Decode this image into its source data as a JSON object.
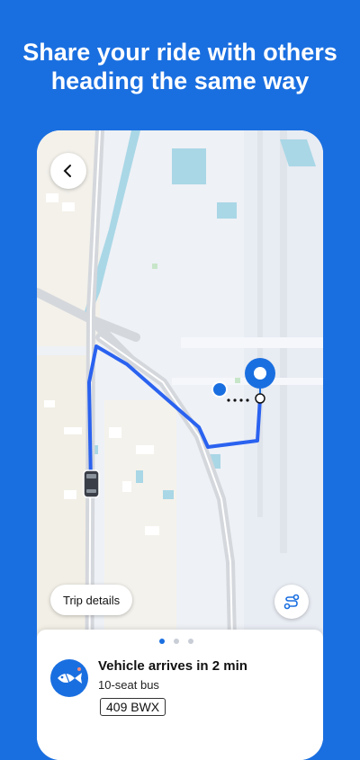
{
  "headline": {
    "line1": "Share your ride with others",
    "line2": "heading the same way"
  },
  "colors": {
    "brand_blue": "#1a6fe0",
    "route_blue": "#2a62f0",
    "map_land": "#eef1f6",
    "map_water": "#a9d7e6",
    "map_road": "#d4d7dc"
  },
  "map": {
    "back_icon": "chevron-left-icon",
    "trip_details_label": "Trip details",
    "route_icon": "route-icon",
    "vehicle_icon": "car-icon",
    "destination_icon": "destination-pin-icon",
    "origin_icon": "user-location-icon"
  },
  "sheet": {
    "page_count": 3,
    "active_page": 1,
    "icon": "fish-logo-icon",
    "arrival_text": "Vehicle arrives in 2 min",
    "vehicle_type": "10-seat bus",
    "plate": "409 BWX"
  }
}
